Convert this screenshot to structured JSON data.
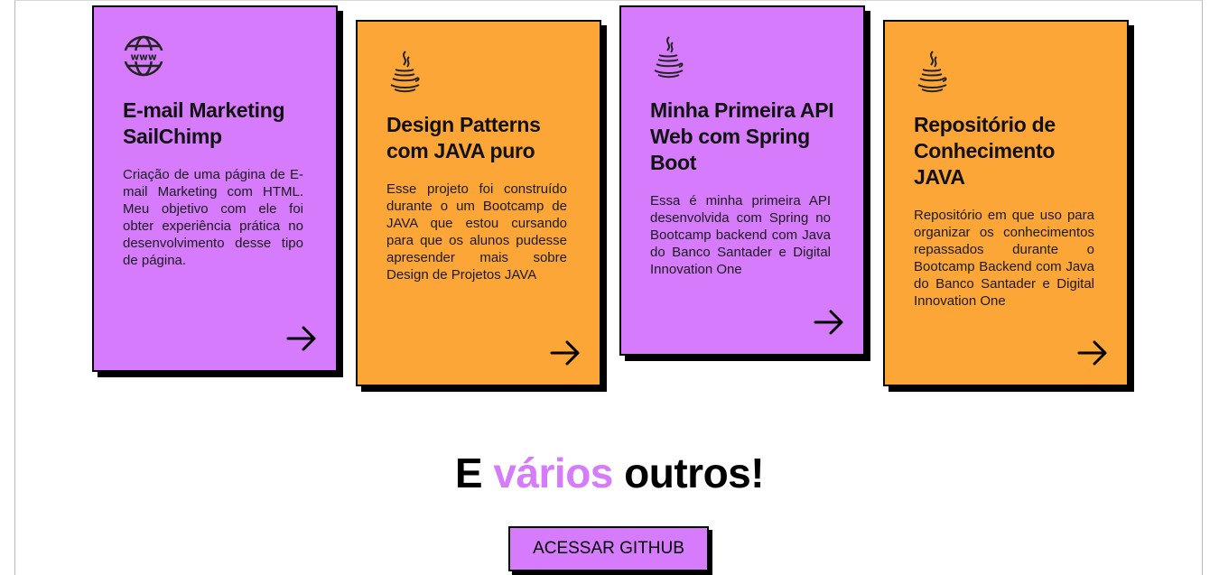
{
  "colors": {
    "purple": "#d57bfc",
    "orange": "#fca638",
    "border": "#000000"
  },
  "projects": [
    {
      "icon": "www-globe-icon",
      "title": "E-mail Marketing SailChimp",
      "description": "Criação de uma página de E-mail Marketing com HTML. Meu objetivo com ele foi obter experiência prática no desenvolvimento desse tipo de página.",
      "color": "purple"
    },
    {
      "icon": "java-icon",
      "title": "Design Patterns com JAVA puro",
      "description": "Esse projeto foi construído durante o um Bootcamp de JAVA que estou cursando para que os alunos pudesse apresender mais sobre Design de Projetos JAVA",
      "color": "orange"
    },
    {
      "icon": "java-icon",
      "title": "Minha Primeira API Web com Spring Boot",
      "description": "Essa é minha primeira API desenvolvida com Spring no Bootcamp backend com Java do Banco Santader e Digital Innovation One",
      "color": "purple"
    },
    {
      "icon": "java-icon",
      "title": "Repositório de Conhecimento JAVA",
      "description": "Repositório em que uso para organizar os conhecimentos repassados durante o Bootcamp Backend com Java do Banco Santader e Digital Innovation One",
      "color": "orange"
    }
  ],
  "headline": {
    "prefix": "E ",
    "accent": "vários",
    "suffix": " outros!"
  },
  "github_button": {
    "label": "ACESSAR GITHUB"
  }
}
